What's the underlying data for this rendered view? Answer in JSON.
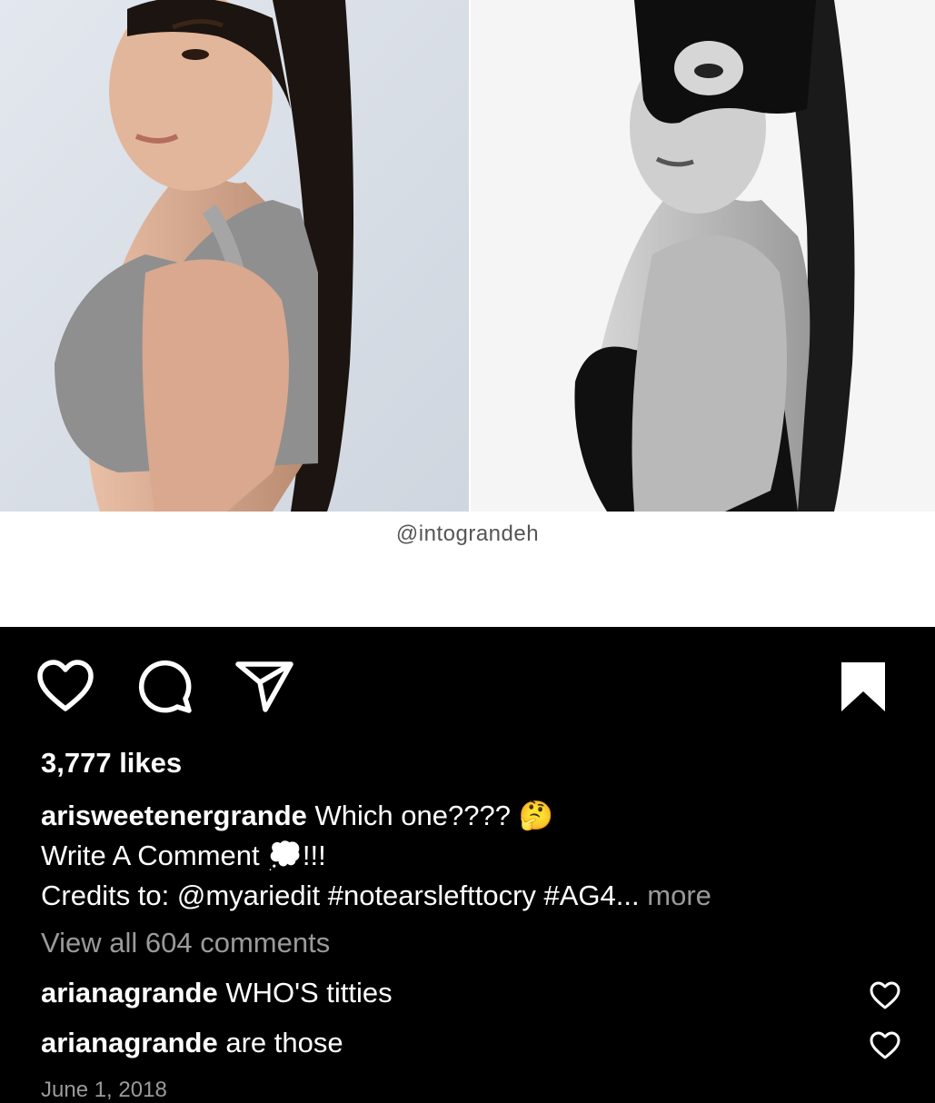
{
  "post": {
    "watermark": "@intograndeh",
    "likes": "3,777 likes",
    "caption": {
      "username": "arisweetenergrande",
      "line1": "Which one????",
      "line1_emoji": "🤔",
      "line2_text": "Write A Comment",
      "line2_emoji": "💭",
      "line2_end": "!!!",
      "line3": "Credits to: @myariedit #notearslefttocry #AG4...",
      "more": "more"
    },
    "view_all": "View all 604 comments",
    "comments": [
      {
        "username": "arianagrande",
        "text": "WHO'S titties"
      },
      {
        "username": "arianagrande",
        "text": "are those"
      }
    ],
    "date": "June 1, 2018"
  },
  "icons": {
    "like": "heart-icon",
    "comment": "comment-bubble-icon",
    "share": "paper-plane-icon",
    "save": "bookmark-icon",
    "comment_like": "small-heart-icon"
  },
  "colors": {
    "background": "#000000",
    "text": "#ffffff",
    "muted": "#9a9a9a"
  }
}
